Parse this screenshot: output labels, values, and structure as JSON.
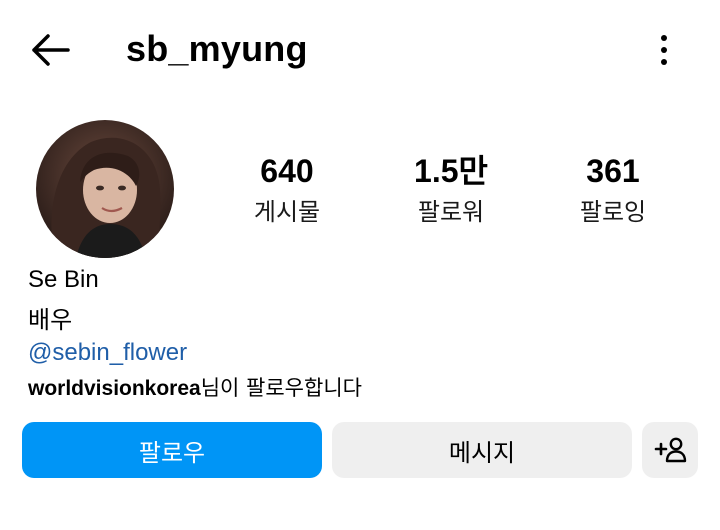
{
  "header": {
    "username": "sb_myung"
  },
  "stats": [
    {
      "value": "640",
      "label": "게시물"
    },
    {
      "value": "1.5만",
      "label": "팔로워"
    },
    {
      "value": "361",
      "label": "팔로잉"
    }
  ],
  "profile": {
    "name": "Se Bin",
    "bio": "배우",
    "link": "@sebin_flower",
    "followed_by_account": "worldvisionkorea",
    "followed_by_suffix": "님이 팔로우합니다"
  },
  "actions": {
    "follow_label": "팔로우",
    "message_label": "메시지"
  },
  "icons": {
    "back": "back-arrow-icon",
    "more": "more-vertical-icon",
    "add_user": "add-user-icon"
  },
  "colors": {
    "primary": "#0095f6",
    "secondary_button": "#efefef",
    "link": "#1f5ea8"
  }
}
